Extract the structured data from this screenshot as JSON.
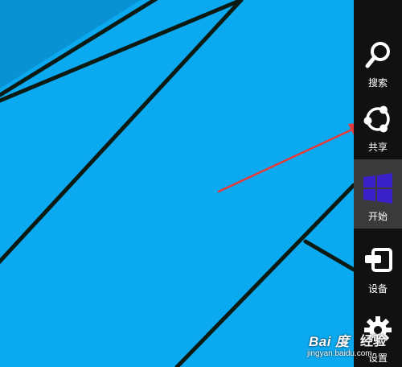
{
  "charms": [
    {
      "label": "搜索",
      "icon": "search-icon"
    },
    {
      "label": "共享",
      "icon": "share-icon"
    },
    {
      "label": "开始",
      "icon": "windows-logo-icon"
    },
    {
      "label": "设备",
      "icon": "devices-icon"
    },
    {
      "label": "设置",
      "icon": "settings-gear-icon"
    }
  ],
  "watermark": {
    "brand": "Bai 度",
    "jingyan": "经验",
    "url": "jingyan.baidu.com"
  },
  "colors": {
    "desktop": "#0aa9f0",
    "charm_bar": "#111111",
    "start_logo": "#3a20c8",
    "arrow": "#e83a3a"
  }
}
